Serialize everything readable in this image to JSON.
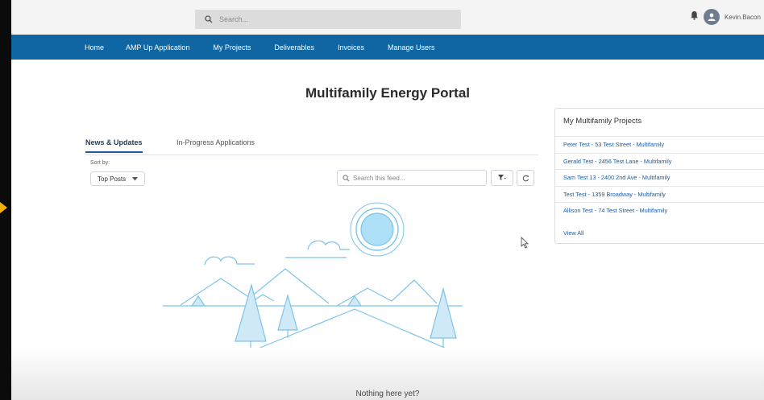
{
  "header": {
    "search_placeholder": "Search...",
    "username": "Kevin.Bacon",
    "icons": {
      "search": "search-icon",
      "notifications": "bell-icon",
      "avatar": "user-avatar-icon"
    }
  },
  "nav": {
    "items": [
      {
        "label": "Home"
      },
      {
        "label": "AMP Up Application"
      },
      {
        "label": "My Projects"
      },
      {
        "label": "Deliverables"
      },
      {
        "label": "Invoices"
      },
      {
        "label": "Manage Users"
      }
    ]
  },
  "main": {
    "title": "Multifamily Energy Portal",
    "tabs": [
      {
        "label": "News & Updates",
        "active": true
      },
      {
        "label": "In-Progress Applications",
        "active": false
      }
    ],
    "sort_label": "Sort by:",
    "sort_value": "Top Posts",
    "feed_search_placeholder": "Search this feed...",
    "empty_message": "Nothing here yet?"
  },
  "projects_card": {
    "title": "My Multifamily Projects",
    "items": [
      "Peter Test - 53 Test Street - Multifamily",
      "Gerald Test - 2456 Test Lane - Multifamily",
      "Sam Test 13 - 2400 2nd Ave - Multifamily",
      "Test Test - 1359 Broadway - Multifamily",
      "Allison Test - 74 Test Street - Multifamily"
    ],
    "view_all": "View All"
  },
  "colors": {
    "nav_bg": "#0f66a3",
    "link": "#1b5ea5",
    "illustration": "#7cc4ea",
    "marker": "#f3b200"
  }
}
